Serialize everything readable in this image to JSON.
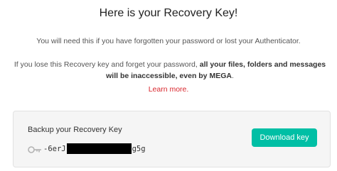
{
  "dialog": {
    "title": "Here is your Recovery Key!",
    "subtitle": "You will need this if you have forgotten your password or lost your Authenticator.",
    "warning_prefix": "If you lose this Recovery key and forget your password, ",
    "warning_bold": "all your files, folders and messages will be inaccessible, even by MEGA",
    "warning_suffix": ".",
    "learn_more": "Learn more."
  },
  "backup": {
    "label": "Backup your Recovery Key",
    "key_start": "-6erJ",
    "key_end": "g5g",
    "download_label": "Download key",
    "icon": "key-icon"
  },
  "colors": {
    "accent": "#00bfa5",
    "link": "#d9272e",
    "panel_bg": "#f5f5f5"
  }
}
